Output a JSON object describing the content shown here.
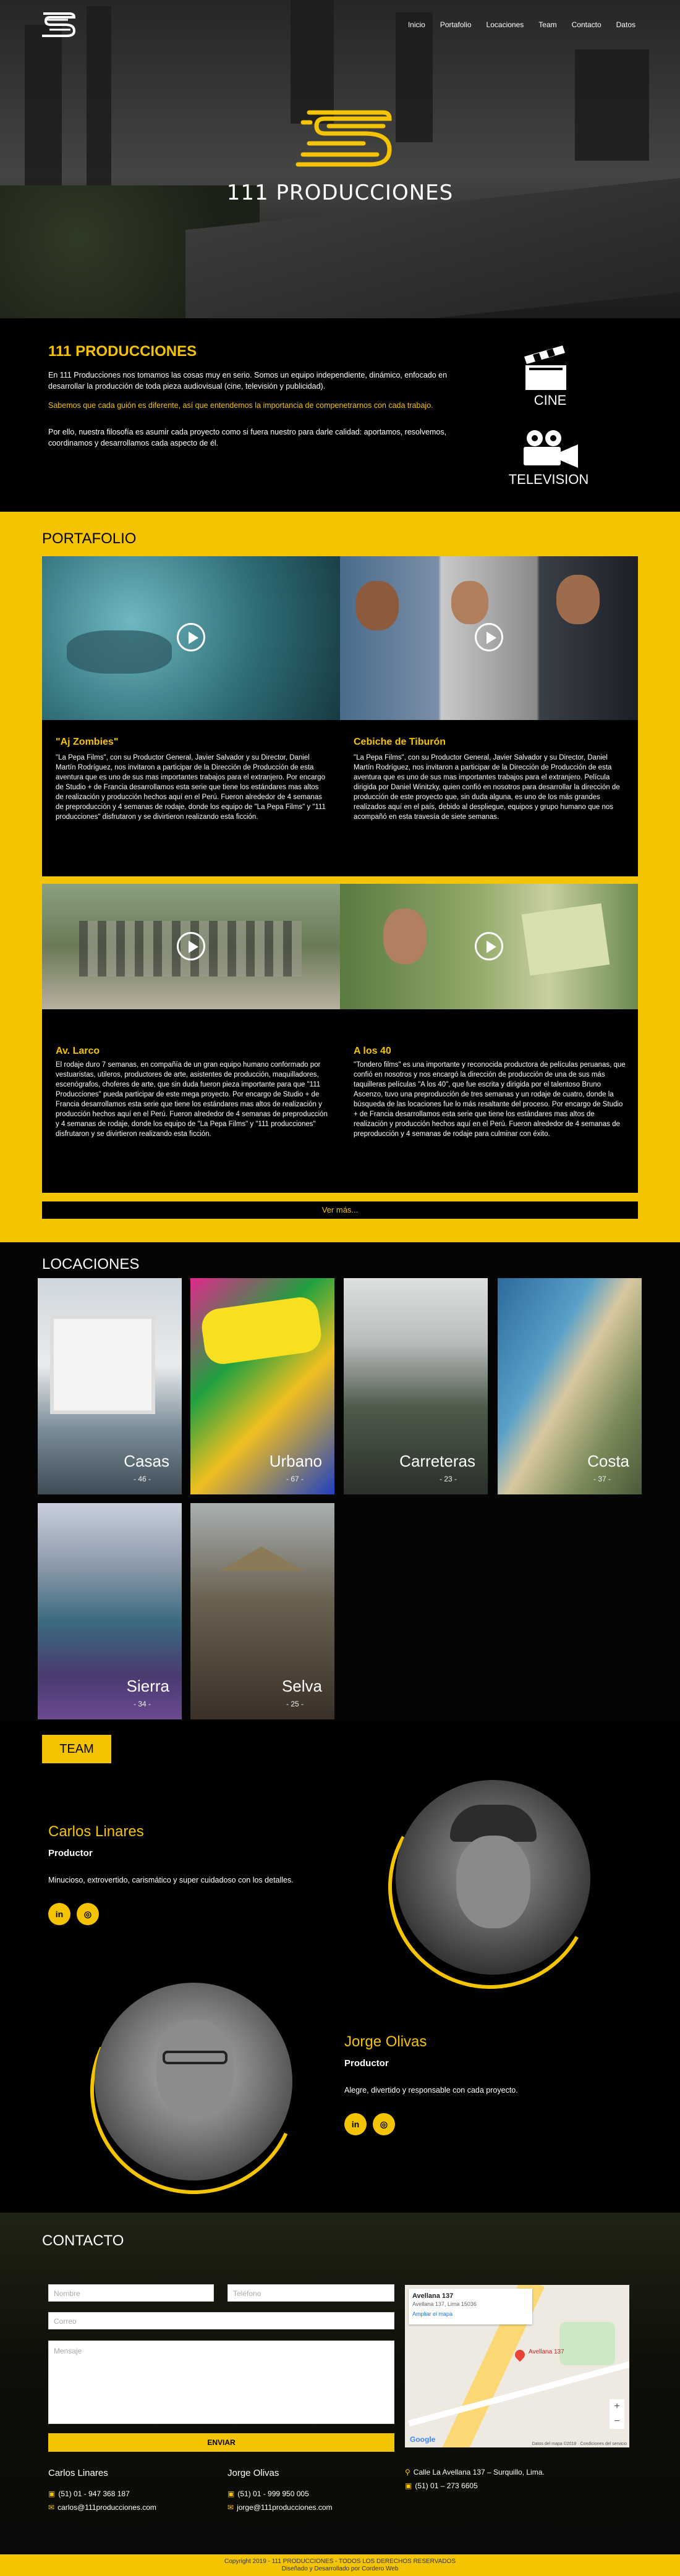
{
  "nav": [
    "Inicio",
    "Portafolio",
    "Locaciones",
    "Team",
    "Contacto",
    "Datos"
  ],
  "hero": {
    "title": "111 PRODUCCIONES"
  },
  "about": {
    "title": "111 PRODUCCIONES",
    "p1": "En 111 Producciones nos tomamos las cosas muy en serio. Somos un equipo independiente, dinámico, enfocado en desarrollar la producción de toda pieza audiovisual (cine, televisión y publicidad).",
    "p2": "Sabemos que cada guión es diferente, así que entendemos la importancia de compenetrarnos con cada trabajo.",
    "p3": "Por ello, nuestra filosofía es asumir cada proyecto como si fuera nuestro para darle calidad: aportamos, resolvemos, coordinamos y desarrollamos cada aspecto de él.",
    "cine_label": "CINE",
    "tv_label": "TELEVISION"
  },
  "portfolio": {
    "title": "PORTAFOLIO",
    "more": "Ver más...",
    "items": [
      {
        "title": "\"Aj Zombies\"",
        "text": "\"La Pepa Films\", con su Productor General, Javier Salvador y su Director, Daniel Martín Rodríguez, nos invitaron a participar de la Dirección de Producción de esta aventura que es uno de sus mas importantes trabajos para el extranjero. Por encargo de Studio + de Francia desarrollamos esta serie que tiene los estándares mas altos de realización y producción hechos aquí en el Perú. Fueron alrededor de 4 semanas de preproducción y 4 semanas de rodaje, donde los equipo de \"La Pepa Films\" y \"111 producciones\" disfrutaron y se divirtieron realizando esta ficción."
      },
      {
        "title": "Cebiche de Tiburón",
        "text": "\"La Pepa Films\", con su Productor General, Javier Salvador y su Director, Daniel Martín Rodríguez, nos invitaron a participar de la Dirección de Producción de esta aventura que es uno de sus mas importantes trabajos para el extranjero. Película dirigida por Daniel Winitzky, quien confió en nosotros para desarrollar la dirección de producción de este proyecto que, sin duda alguna, es uno de los más grandes realizados aquí en el país, debido al despliegue, equipos y grupo humano que nos acompañó en esta travesía de siete semanas."
      },
      {
        "title": "Av. Larco",
        "text": "El rodaje duro 7 semanas, en compañía de un gran equipo humano conformado por vestuaristas, utileros, productores de arte, asistentes de producción, maquilladores, escenógrafos, choferes de arte, que sin duda fueron pieza importante para que \"111 Producciones\" pueda participar de este mega proyecto. Por encargo de Studio + de Francia desarrollamos esta serie que tiene los estándares mas altos de realización y producción hechos aquí en el Perú. Fueron alrededor de 4 semanas de preproducción y 4 semanas de rodaje, donde los equipo de \"La Pepa Films\" y \"111 producciones\" disfrutaron y se divirtieron realizando esta ficción."
      },
      {
        "title": "A los 40",
        "text": "\"Tondero films\" es una importante y reconocida productora de películas peruanas, que confió en nosotros y nos encargó la dirección de producción de una de sus más taquilleras películas \"A los 40\", que fue escrita y dirigida por el talentoso Bruno Ascenzo, tuvo una preproducción de tres semanas y un rodaje de cuatro, donde la búsqueda de las locaciones fue lo más resaltante del proceso. Por encargo de Studio + de Francia desarrollamos esta serie que tiene los estándares mas altos de realización y producción hechos aquí en el Perú. Fueron alrededor de 4 semanas de preproducción y 4 semanas de rodaje para culminar con éxito."
      }
    ]
  },
  "locaciones": {
    "title": "LOCACIONES",
    "items": [
      {
        "name": "Casas",
        "count": "- 46 -"
      },
      {
        "name": "Urbano",
        "count": "- 67 -"
      },
      {
        "name": "Carreteras",
        "count": "- 23 -"
      },
      {
        "name": "Costa",
        "count": "- 37 -"
      },
      {
        "name": "Sierra",
        "count": "- 34 -"
      },
      {
        "name": "Selva",
        "count": "- 25 -"
      }
    ]
  },
  "team": {
    "button": "TEAM",
    "members": [
      {
        "name": "Carlos Linares",
        "role": "Productor",
        "desc": "Minucioso, extrovertido, carismático y super cuidadoso con los detalles."
      },
      {
        "name": "Jorge Olivas",
        "role": "Productor",
        "desc": "Alegre, divertido y responsable con cada proyecto."
      }
    ],
    "social_in": "in",
    "social_ig": "◎"
  },
  "contact": {
    "title": "CONTACTO",
    "placeholders": {
      "name": "Nombre",
      "phone": "Teléfono",
      "email": "Correo",
      "message": "Mensaje"
    },
    "send": "ENVIAR",
    "map": {
      "place": "Avellana 137",
      "address": "Avellana 137, Lima 15036",
      "link": "Ampliar el mapa",
      "pin": "Avellana 137",
      "google": "Google",
      "credits": "Datos del mapa ©2019 · Condiciones del servicio"
    },
    "col1": {
      "name": "Carlos Linares",
      "phone": "(51) 01 - 947 368 187",
      "email": "carlos@111producciones.com"
    },
    "col2": {
      "name": "Jorge Olivas",
      "phone": "(51) 01 - 999 950 005",
      "email": "jorge@111producciones.com"
    },
    "col3": {
      "address": "Calle La Avellana 137 – Surquillo, Lima.",
      "phone": "(51) 01 – 273 6605"
    }
  },
  "footer": {
    "line1": "Copyright 2019 - 111 PRODUCCIONES - TODOS LOS DERECHOS RESERVADOS",
    "line2": "Diseñado y Desarrollado por Cordero Web"
  },
  "colors": {
    "accent": "#f5c400",
    "dark": "#000000"
  }
}
